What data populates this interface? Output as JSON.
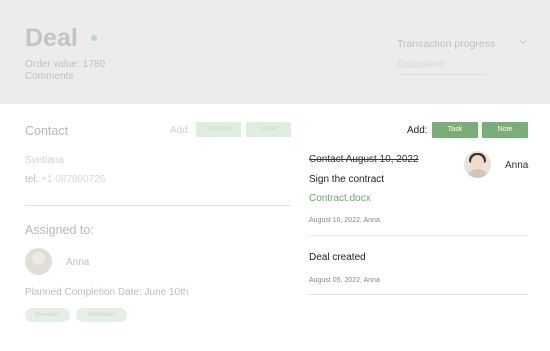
{
  "header": {
    "title": "Deal",
    "order_value": "Order value: 1780",
    "comments": "Comments",
    "transaction_progress_label": "Transaction progress",
    "transaction_progress_value": "Discussion"
  },
  "contact": {
    "title": "Contact",
    "add_label": "Add:",
    "buttons": [
      "Company",
      "Sender"
    ],
    "name": "Svetlana",
    "tel_label": "tel:",
    "tel_value": "+1 087890726"
  },
  "assigned": {
    "title": "Assigned to:",
    "name": "Anna",
    "planned_date": "Planned Completion Date: June 10th",
    "tags": [
      "Reminder",
      "Notification"
    ]
  },
  "activity": {
    "add_label": "Add:",
    "buttons": [
      "Task",
      "Note"
    ],
    "entries": [
      {
        "title": "Contact August 10, 2022",
        "user": "Anna",
        "line": "Sign the contract",
        "file": "Contract.docx",
        "meta": "August 10, 2022, Anna"
      },
      {
        "title": "Deal created",
        "meta": "August 05, 2022, Anna"
      }
    ]
  },
  "colors": {
    "accent_green": "#7aae79",
    "link_green": "#6aa86a",
    "header_bg": "#ececec"
  }
}
